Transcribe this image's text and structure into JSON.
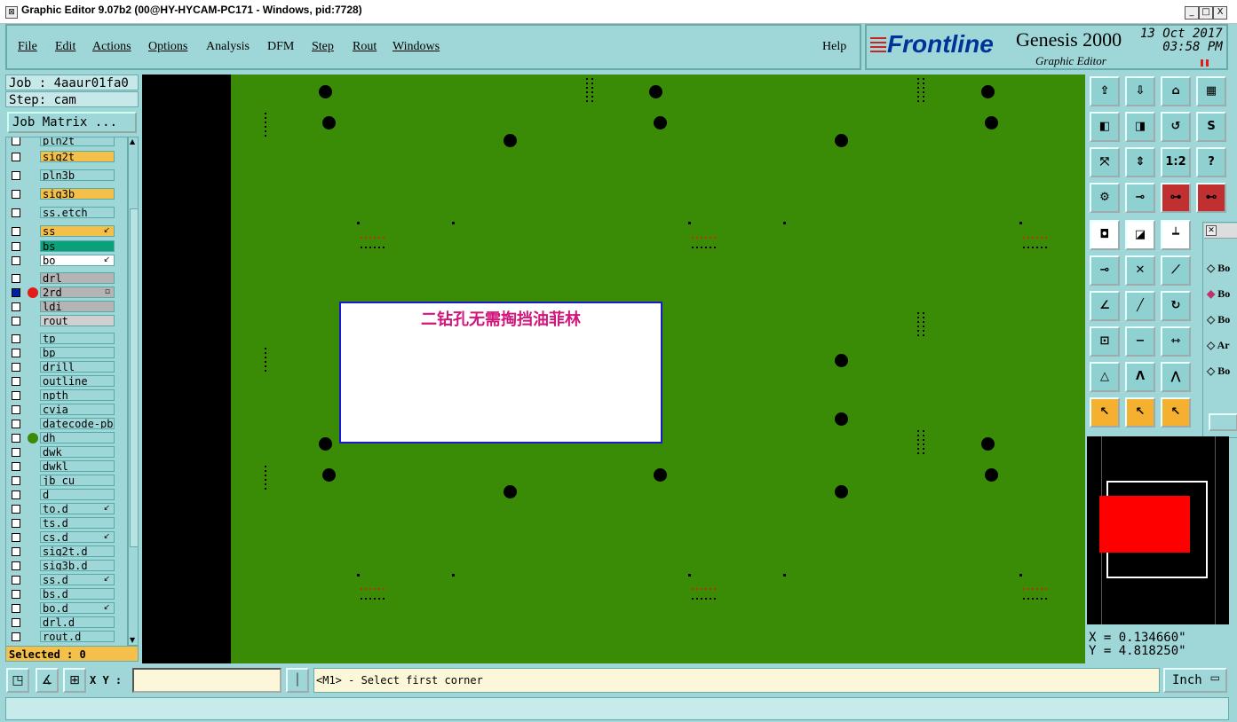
{
  "window": {
    "title": "Graphic Editor 9.07b2 (00@HY-HYCAM-PC171 - Windows, pid:7728)",
    "controls": [
      "_",
      "□",
      "X"
    ]
  },
  "menu": {
    "items": [
      "File",
      "Edit",
      "Actions",
      "Options",
      "Analysis",
      "DFM",
      "Step",
      "Rout",
      "Windows"
    ],
    "help": "Help"
  },
  "brand": {
    "logo": "Frontline",
    "product": "Genesis 2000",
    "subtitle": "Graphic Editor",
    "date": "13 Oct 2017",
    "time": "03:58 PM"
  },
  "left": {
    "job": "Job : 4aaur01fa0",
    "step": "Step: cam",
    "job_matrix": "Job Matrix ...",
    "selected": "Selected : 0",
    "layers": [
      {
        "name": "pln2t",
        "color": "#9fd7d8",
        "cb": false,
        "dot": "",
        "mark": ""
      },
      {
        "name": "sig2t",
        "color": "#f5c04a",
        "cb": false,
        "dot": "",
        "mark": ""
      },
      {
        "name": "pln3b",
        "color": "#9fd7d8",
        "cb": false,
        "dot": "",
        "mark": ""
      },
      {
        "name": "sig3b",
        "color": "#f5c04a",
        "cb": false,
        "dot": "",
        "mark": ""
      },
      {
        "name": "ss.etch",
        "color": "#9fd7d8",
        "cb": false,
        "dot": "",
        "mark": ""
      },
      {
        "name": "ss",
        "color": "#f5c04a",
        "cb": false,
        "dot": "",
        "mark": "↙"
      },
      {
        "name": "bs",
        "color": "#0aa17a",
        "cb": false,
        "dot": "",
        "mark": ""
      },
      {
        "name": "bo",
        "color": "#ffffff",
        "cb": false,
        "dot": "",
        "mark": "↙"
      },
      {
        "name": "drl",
        "color": "#b4b4b4",
        "cb": false,
        "dot": "",
        "mark": ""
      },
      {
        "name": "2rd",
        "color": "#b4b4b4",
        "cb": true,
        "dot": "#e31b1b",
        "mark": "▫"
      },
      {
        "name": "ldi",
        "color": "#b4b4b4",
        "cb": false,
        "dot": "",
        "mark": ""
      },
      {
        "name": "rout",
        "color": "#d0d0d0",
        "cb": false,
        "dot": "",
        "mark": ""
      },
      {
        "name": "tp",
        "color": "#9fd7d8",
        "cb": false,
        "dot": "",
        "mark": ""
      },
      {
        "name": "bp",
        "color": "#9fd7d8",
        "cb": false,
        "dot": "",
        "mark": ""
      },
      {
        "name": "drill",
        "color": "#9fd7d8",
        "cb": false,
        "dot": "",
        "mark": ""
      },
      {
        "name": "outline",
        "color": "#9fd7d8",
        "cb": false,
        "dot": "",
        "mark": ""
      },
      {
        "name": "npth",
        "color": "#9fd7d8",
        "cb": false,
        "dot": "",
        "mark": ""
      },
      {
        "name": "cvia",
        "color": "#9fd7d8",
        "cb": false,
        "dot": "",
        "mark": ""
      },
      {
        "name": "datecode-pbe",
        "color": "#9fd7d8",
        "cb": false,
        "dot": "",
        "mark": ""
      },
      {
        "name": "dh",
        "color": "#9fd7d8",
        "cb": false,
        "dot": "#3a8c06",
        "mark": ""
      },
      {
        "name": "dwk",
        "color": "#9fd7d8",
        "cb": false,
        "dot": "",
        "mark": ""
      },
      {
        "name": "dwkl",
        "color": "#9fd7d8",
        "cb": false,
        "dot": "",
        "mark": ""
      },
      {
        "name": "jb_cu",
        "color": "#9fd7d8",
        "cb": false,
        "dot": "",
        "mark": ""
      },
      {
        "name": "d",
        "color": "#9fd7d8",
        "cb": false,
        "dot": "",
        "mark": ""
      },
      {
        "name": "to.d",
        "color": "#9fd7d8",
        "cb": false,
        "dot": "",
        "mark": "↙"
      },
      {
        "name": "ts.d",
        "color": "#9fd7d8",
        "cb": false,
        "dot": "",
        "mark": ""
      },
      {
        "name": "cs.d",
        "color": "#9fd7d8",
        "cb": false,
        "dot": "",
        "mark": "↙"
      },
      {
        "name": "sig2t.d",
        "color": "#9fd7d8",
        "cb": false,
        "dot": "",
        "mark": ""
      },
      {
        "name": "sig3b.d",
        "color": "#9fd7d8",
        "cb": false,
        "dot": "",
        "mark": ""
      },
      {
        "name": "ss.d",
        "color": "#9fd7d8",
        "cb": false,
        "dot": "",
        "mark": "↙"
      },
      {
        "name": "bs.d",
        "color": "#9fd7d8",
        "cb": false,
        "dot": "",
        "mark": ""
      },
      {
        "name": "bo.d",
        "color": "#9fd7d8",
        "cb": false,
        "dot": "",
        "mark": "↙"
      },
      {
        "name": "drl.d",
        "color": "#9fd7d8",
        "cb": false,
        "dot": "",
        "mark": ""
      },
      {
        "name": "rout.d",
        "color": "#9fd7d8",
        "cb": false,
        "dot": "",
        "mark": ""
      }
    ]
  },
  "canvas": {
    "note": "二钻孔无需掏挡油菲林",
    "board_color": "#3a8c06"
  },
  "tools": {
    "rows": [
      [
        {
          "icon": "open-icon",
          "g": "⇪"
        },
        {
          "icon": "save-icon",
          "g": "⇩"
        },
        {
          "icon": "home-icon",
          "g": "⌂"
        },
        {
          "icon": "window-icon",
          "g": "▦"
        }
      ],
      [
        {
          "icon": "pan-left-icon",
          "g": "◧"
        },
        {
          "icon": "pan-right-icon",
          "g": "◨"
        },
        {
          "icon": "undo-icon",
          "g": "↺"
        },
        {
          "icon": "s-curve-icon",
          "g": "S"
        }
      ],
      [
        {
          "icon": "fit-icon",
          "g": "⤧"
        },
        {
          "icon": "zoom-icon",
          "g": "⇕"
        },
        {
          "icon": "scale-icon",
          "g": "1:2"
        },
        {
          "icon": "help-icon",
          "g": "?"
        }
      ],
      [
        {
          "icon": "tools-icon",
          "g": "⚙"
        },
        {
          "icon": "probe-icon",
          "g": "⊸"
        },
        {
          "icon": "net-icon",
          "g": "⊶",
          "style": "red"
        },
        {
          "icon": "net-alt-icon",
          "g": "⊷",
          "style": "red"
        }
      ],
      [
        {
          "icon": "snap-icon",
          "g": "◘",
          "style": "white"
        },
        {
          "icon": "shape-icon",
          "g": "◪",
          "style": "white"
        },
        {
          "icon": "ruler-icon",
          "g": "┷",
          "style": "white"
        }
      ],
      [
        {
          "icon": "connect-icon",
          "g": "⊸"
        },
        {
          "icon": "cross-icon",
          "g": "✕"
        },
        {
          "icon": "line-icon",
          "g": "⟋"
        }
      ],
      [
        {
          "icon": "angle-icon",
          "g": "∠"
        },
        {
          "icon": "slash-icon",
          "g": "╱"
        },
        {
          "icon": "rotate-icon",
          "g": "↻"
        }
      ],
      [
        {
          "icon": "move-icon",
          "g": "⊡"
        },
        {
          "icon": "minus-icon",
          "g": "−"
        },
        {
          "icon": "flip-icon",
          "g": "⇿"
        }
      ],
      [
        {
          "icon": "tri-icon",
          "g": "△"
        },
        {
          "icon": "peak-icon",
          "g": "Λ"
        },
        {
          "icon": "arch-icon",
          "g": "⋀"
        }
      ],
      [
        {
          "icon": "select-icon",
          "g": "↖",
          "style": "orange"
        },
        {
          "icon": "select-box-icon",
          "g": "↖",
          "style": "orange"
        },
        {
          "icon": "select-circle-icon",
          "g": "↖",
          "style": "orange"
        }
      ]
    ]
  },
  "popup": {
    "items": [
      "Bo",
      "Bo",
      "Bo",
      "Ar",
      "Bo"
    ]
  },
  "coords": {
    "x": "X = 0.134660\"",
    "y": "Y = 4.818250\""
  },
  "bottom": {
    "xy_label": "X Y :",
    "xy_value": "",
    "prompt": "<M1> - Select first corner",
    "units": "Inch"
  }
}
